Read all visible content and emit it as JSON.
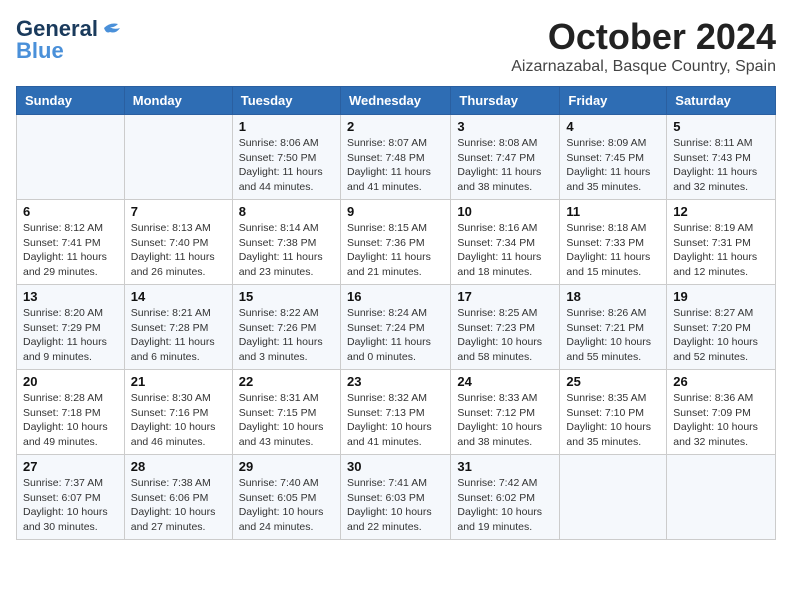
{
  "logo": {
    "line1": "General",
    "line2": "Blue"
  },
  "title": "October 2024",
  "location": "Aizarnazabal, Basque Country, Spain",
  "days_of_week": [
    "Sunday",
    "Monday",
    "Tuesday",
    "Wednesday",
    "Thursday",
    "Friday",
    "Saturday"
  ],
  "weeks": [
    [
      {
        "day": null,
        "info": null
      },
      {
        "day": null,
        "info": null
      },
      {
        "day": "1",
        "info": "Sunrise: 8:06 AM\nSunset: 7:50 PM\nDaylight: 11 hours and 44 minutes."
      },
      {
        "day": "2",
        "info": "Sunrise: 8:07 AM\nSunset: 7:48 PM\nDaylight: 11 hours and 41 minutes."
      },
      {
        "day": "3",
        "info": "Sunrise: 8:08 AM\nSunset: 7:47 PM\nDaylight: 11 hours and 38 minutes."
      },
      {
        "day": "4",
        "info": "Sunrise: 8:09 AM\nSunset: 7:45 PM\nDaylight: 11 hours and 35 minutes."
      },
      {
        "day": "5",
        "info": "Sunrise: 8:11 AM\nSunset: 7:43 PM\nDaylight: 11 hours and 32 minutes."
      }
    ],
    [
      {
        "day": "6",
        "info": "Sunrise: 8:12 AM\nSunset: 7:41 PM\nDaylight: 11 hours and 29 minutes."
      },
      {
        "day": "7",
        "info": "Sunrise: 8:13 AM\nSunset: 7:40 PM\nDaylight: 11 hours and 26 minutes."
      },
      {
        "day": "8",
        "info": "Sunrise: 8:14 AM\nSunset: 7:38 PM\nDaylight: 11 hours and 23 minutes."
      },
      {
        "day": "9",
        "info": "Sunrise: 8:15 AM\nSunset: 7:36 PM\nDaylight: 11 hours and 21 minutes."
      },
      {
        "day": "10",
        "info": "Sunrise: 8:16 AM\nSunset: 7:34 PM\nDaylight: 11 hours and 18 minutes."
      },
      {
        "day": "11",
        "info": "Sunrise: 8:18 AM\nSunset: 7:33 PM\nDaylight: 11 hours and 15 minutes."
      },
      {
        "day": "12",
        "info": "Sunrise: 8:19 AM\nSunset: 7:31 PM\nDaylight: 11 hours and 12 minutes."
      }
    ],
    [
      {
        "day": "13",
        "info": "Sunrise: 8:20 AM\nSunset: 7:29 PM\nDaylight: 11 hours and 9 minutes."
      },
      {
        "day": "14",
        "info": "Sunrise: 8:21 AM\nSunset: 7:28 PM\nDaylight: 11 hours and 6 minutes."
      },
      {
        "day": "15",
        "info": "Sunrise: 8:22 AM\nSunset: 7:26 PM\nDaylight: 11 hours and 3 minutes."
      },
      {
        "day": "16",
        "info": "Sunrise: 8:24 AM\nSunset: 7:24 PM\nDaylight: 11 hours and 0 minutes."
      },
      {
        "day": "17",
        "info": "Sunrise: 8:25 AM\nSunset: 7:23 PM\nDaylight: 10 hours and 58 minutes."
      },
      {
        "day": "18",
        "info": "Sunrise: 8:26 AM\nSunset: 7:21 PM\nDaylight: 10 hours and 55 minutes."
      },
      {
        "day": "19",
        "info": "Sunrise: 8:27 AM\nSunset: 7:20 PM\nDaylight: 10 hours and 52 minutes."
      }
    ],
    [
      {
        "day": "20",
        "info": "Sunrise: 8:28 AM\nSunset: 7:18 PM\nDaylight: 10 hours and 49 minutes."
      },
      {
        "day": "21",
        "info": "Sunrise: 8:30 AM\nSunset: 7:16 PM\nDaylight: 10 hours and 46 minutes."
      },
      {
        "day": "22",
        "info": "Sunrise: 8:31 AM\nSunset: 7:15 PM\nDaylight: 10 hours and 43 minutes."
      },
      {
        "day": "23",
        "info": "Sunrise: 8:32 AM\nSunset: 7:13 PM\nDaylight: 10 hours and 41 minutes."
      },
      {
        "day": "24",
        "info": "Sunrise: 8:33 AM\nSunset: 7:12 PM\nDaylight: 10 hours and 38 minutes."
      },
      {
        "day": "25",
        "info": "Sunrise: 8:35 AM\nSunset: 7:10 PM\nDaylight: 10 hours and 35 minutes."
      },
      {
        "day": "26",
        "info": "Sunrise: 8:36 AM\nSunset: 7:09 PM\nDaylight: 10 hours and 32 minutes."
      }
    ],
    [
      {
        "day": "27",
        "info": "Sunrise: 7:37 AM\nSunset: 6:07 PM\nDaylight: 10 hours and 30 minutes."
      },
      {
        "day": "28",
        "info": "Sunrise: 7:38 AM\nSunset: 6:06 PM\nDaylight: 10 hours and 27 minutes."
      },
      {
        "day": "29",
        "info": "Sunrise: 7:40 AM\nSunset: 6:05 PM\nDaylight: 10 hours and 24 minutes."
      },
      {
        "day": "30",
        "info": "Sunrise: 7:41 AM\nSunset: 6:03 PM\nDaylight: 10 hours and 22 minutes."
      },
      {
        "day": "31",
        "info": "Sunrise: 7:42 AM\nSunset: 6:02 PM\nDaylight: 10 hours and 19 minutes."
      },
      {
        "day": null,
        "info": null
      },
      {
        "day": null,
        "info": null
      }
    ]
  ]
}
